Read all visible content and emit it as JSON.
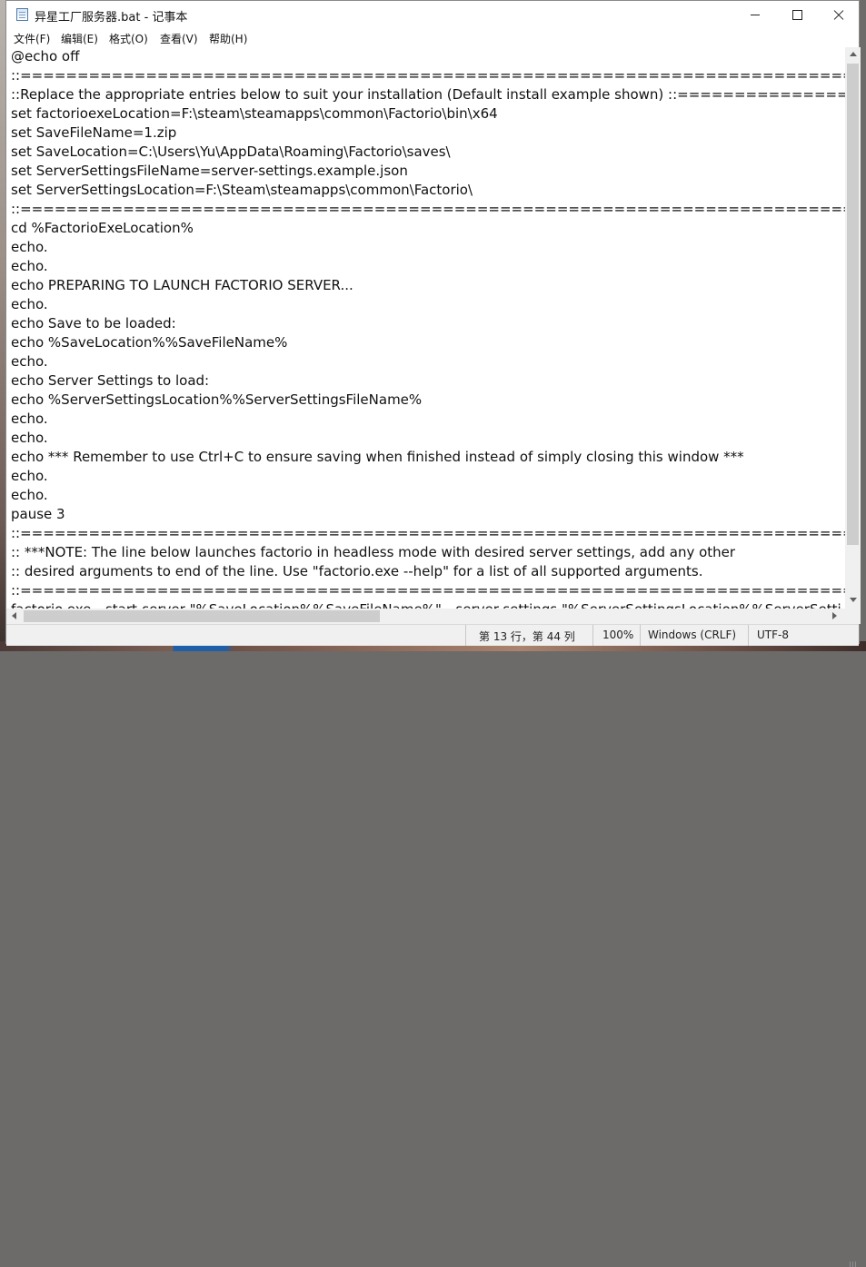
{
  "window": {
    "title": "异星工厂服务器.bat - 记事本",
    "controls": {
      "minimize": "minimize",
      "maximize": "maximize",
      "close": "close"
    }
  },
  "menu": {
    "file": "文件(F)",
    "edit": "编辑(E)",
    "format": "格式(O)",
    "view": "查看(V)",
    "help": "帮助(H)"
  },
  "editor": {
    "lines": [
      "@echo off",
      "::===========================================================================================",
      "::Replace the appropriate entries below to suit your installation (Default install example shown) ::=================",
      "set factorioexeLocation=F:\\steam\\steamapps\\common\\Factorio\\bin\\x64",
      "set SaveFileName=1.zip",
      "set SaveLocation=C:\\Users\\Yu\\AppData\\Roaming\\Factorio\\saves\\",
      "set ServerSettingsFileName=server-settings.example.json",
      "set ServerSettingsLocation=F:\\Steam\\steamapps\\common\\Factorio\\",
      "::===========================================================================================",
      "cd %FactorioExeLocation%",
      "echo.",
      "echo.",
      "echo PREPARING TO LAUNCH FACTORIO SERVER...",
      "echo.",
      "echo Save to be loaded:",
      "echo %SaveLocation%%SaveFileName%",
      "echo.",
      "echo Server Settings to load:",
      "echo %ServerSettingsLocation%%ServerSettingsFileName%",
      "echo.",
      "echo.",
      "echo *** Remember to use Ctrl+C to ensure saving when finished instead of simply closing this window ***",
      "echo.",
      "echo.",
      "pause 3",
      "::===========================================================================================",
      ":: ***NOTE: The line below launches factorio in headless mode with desired server settings, add any other",
      ":: desired arguments to end of the line. Use \"factorio.exe --help\" for a list of all supported arguments.",
      "::===========================================================================================",
      "factorio.exe --start-server \"%SaveLocation%%SaveFileName%\" --server-settings \"%ServerSettingsLocation%%ServerSetti"
    ]
  },
  "status": {
    "position": "第 13 行，第 44 列",
    "zoom": "100%",
    "line_ending": "Windows (CRLF)",
    "encoding": "UTF-8"
  }
}
